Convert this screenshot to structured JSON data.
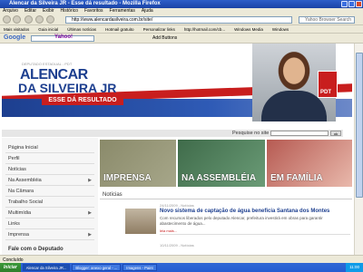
{
  "window": {
    "title": "Alencar da Silveira JR - Esse dá resultado - Mozilla Firefox"
  },
  "menu": [
    "Arquivo",
    "Editar",
    "Exibir",
    "Histórico",
    "Favoritos",
    "Ferramentas",
    "Ajuda"
  ],
  "nav": {
    "url": "http://www.alencardasilveira.com.br/site/",
    "search_placeholder": "Yahoo Browser Search"
  },
  "bookmarks": [
    "Mais visitados",
    "Guia inicial",
    "Últimas notícias",
    "Hotmail gratuito",
    "Personalizar links",
    "http://hotmail.com/cb...",
    "Windows Media",
    "Windows"
  ],
  "google_bar": {
    "label": "Google",
    "yahoo": "Yahoo!",
    "add": "Add Buttons"
  },
  "banner": {
    "tagline": "DEPUTADO ESTADUAL - PDT",
    "name_line1": "ALENCAR",
    "name_line2": "DA SILVEIRA JR",
    "slogan": "ESSE DÁ RESULTADO",
    "party": "PDT"
  },
  "site_search": {
    "label": "Pesquise no site",
    "button": "ok"
  },
  "sidebar": {
    "items": [
      {
        "label": "Página Inicial",
        "arrow": ""
      },
      {
        "label": "Perfil",
        "arrow": ""
      },
      {
        "label": "Notícias",
        "arrow": ""
      },
      {
        "label": "Na Assembléia",
        "arrow": "▶"
      },
      {
        "label": "Na Câmara",
        "arrow": ""
      },
      {
        "label": "Trabalho Social",
        "arrow": ""
      },
      {
        "label": "Multimídia",
        "arrow": "▶"
      },
      {
        "label": "Links",
        "arrow": ""
      },
      {
        "label": "Imprensa",
        "arrow": "▶"
      }
    ],
    "footer": "Fale com o Deputado"
  },
  "tiles": [
    "IMPRENSA",
    "NA ASSEMBLÉIA",
    "EM FAMÍLIA"
  ],
  "news": {
    "section_title": "Notícias",
    "items": [
      {
        "date": "24/11/2009 - Notícias",
        "headline": "Novo sistema de captação de água beneficia Santana dos Montes",
        "text": "Com recursos liberados pelo deputado Alencar, prefeitura investirá em obras para garantir abastecimento de água...",
        "more": "leia mais..."
      },
      {
        "date": "10/11/2009 - Notícias",
        "headline": "",
        "text": "",
        "more": ""
      }
    ]
  },
  "status": "Concluído",
  "taskbar": {
    "start": "Iniciar",
    "tasks": [
      "Alencar da Silveira JR...",
      "Blogger: anexo geral - ...",
      "Imagens - Paint"
    ],
    "clock": "11:00"
  }
}
